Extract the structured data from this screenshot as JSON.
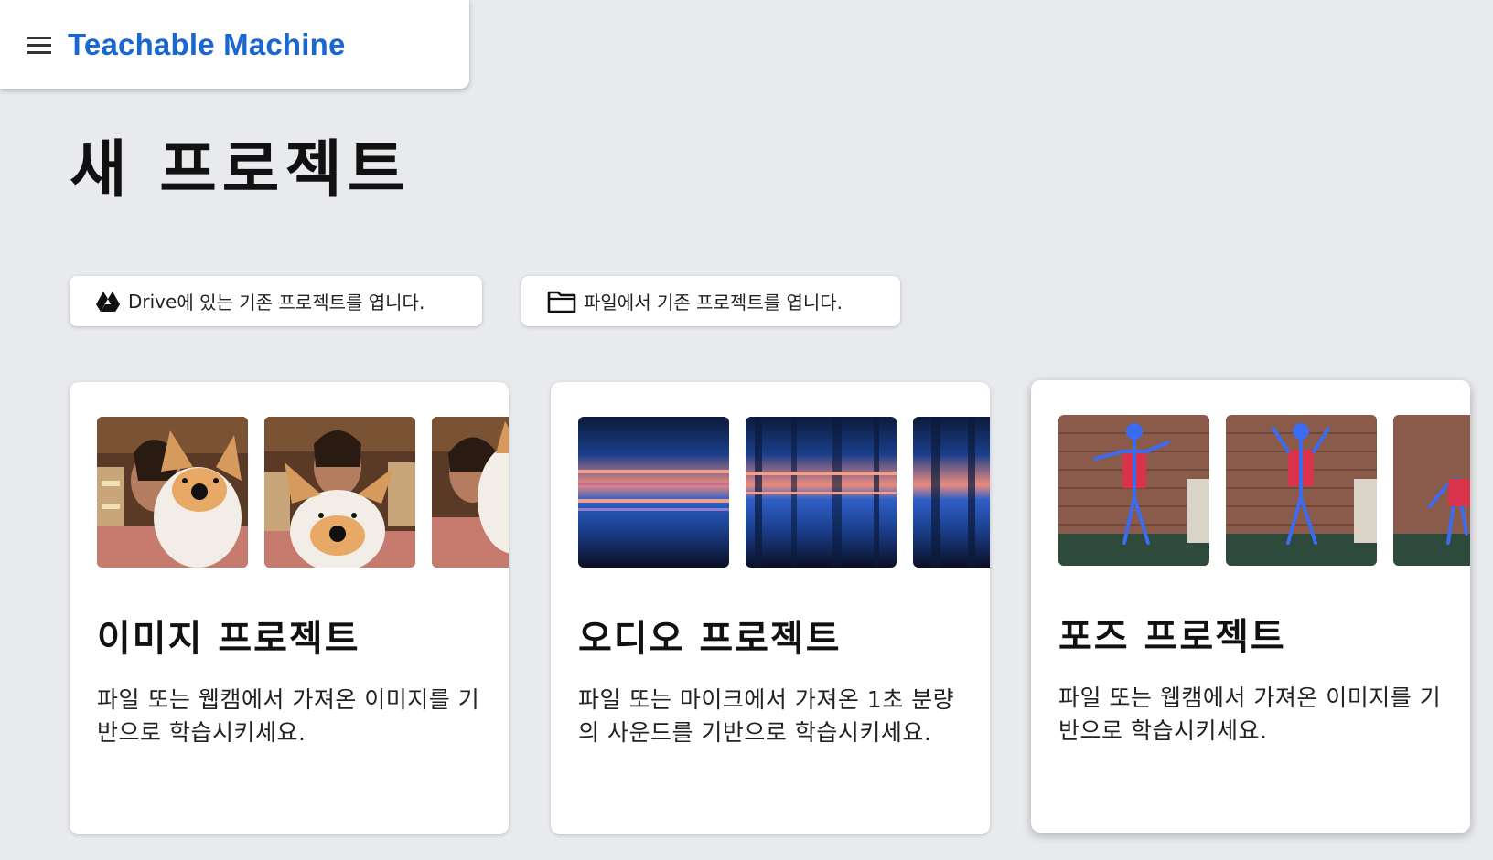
{
  "header": {
    "brand": "Teachable Machine",
    "menu_icon": "hamburger-menu-icon"
  },
  "page": {
    "title": "새 프로젝트"
  },
  "open_buttons": {
    "drive": {
      "label_bold": "Drive",
      "label_rest": "에 있는 기존 프로젝트를 엽니다.",
      "icon": "google-drive-icon"
    },
    "file": {
      "label": "파일에서 기존 프로젝트를 엽니다.",
      "icon": "folder-icon"
    }
  },
  "cards": [
    {
      "title": "이미지 프로젝트",
      "description": "파일 또는 웹캠에서 가져온 이미지를 기반으로 학습시키세요."
    },
    {
      "title": "오디오 프로젝트",
      "description": "파일 또는 마이크에서 가져온 1초 분량의 사운드를 기반으로 학습시키세요."
    },
    {
      "title": "포즈 프로젝트",
      "description": "파일 또는 웹캠에서 가져온 이미지를 기반으로 학습시키세요."
    }
  ],
  "colors": {
    "brand_blue": "#1967d2",
    "background": "#e8eaed",
    "card": "#ffffff"
  }
}
